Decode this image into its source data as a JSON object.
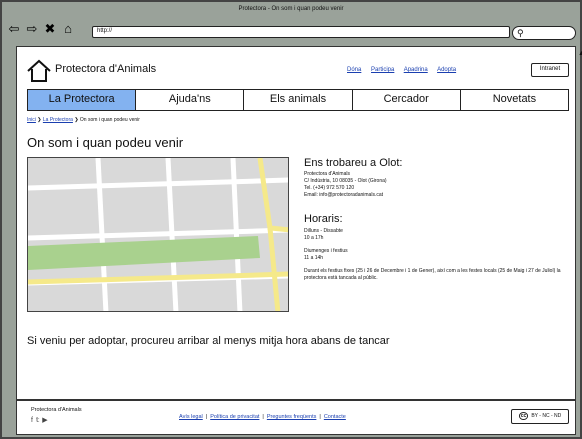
{
  "browser": {
    "window_title": "Protectora - On som i quan podeu venir",
    "url": "http://"
  },
  "header": {
    "site_title": "Protectora d'Animals",
    "links": [
      "Dóna",
      "Participa",
      "Apadrina",
      "Adopta"
    ],
    "intranet_label": "Intranet"
  },
  "nav": {
    "tabs": [
      "La Protectora",
      "Ajuda'ns",
      "Els animals",
      "Cercador",
      "Novetats"
    ]
  },
  "breadcrumb": {
    "items": [
      "Inici",
      "La Protectora"
    ],
    "current": "On som i quan podeu venir"
  },
  "page": {
    "title": "On som i quan podeu venir"
  },
  "location": {
    "heading": "Ens trobareu a Olot:",
    "name": "Protectora d'Animals",
    "address": "C/ Indústria, 10 08035 - Olot (Girona)",
    "phone": "Tel. (+34) 972 570 120",
    "email": "Email: info@protectoradanimals.cat"
  },
  "hours": {
    "heading": "Horaris:",
    "weekday_days": "Dilluns - Dissabte",
    "weekday_time": "10 a 17h",
    "sunday_days": "Diumenges i festius",
    "sunday_time": "11 a 14h",
    "note": "Durant els festius fixes (25 i 26 de Decembre i 1 de Gener), així com a les festes locals (25 de Maig i 27 de Juliol) la protectora està tancada al públic."
  },
  "adoption_note": "Si veniu per adoptar, procureu arribar al menys mitja hora abans de tancar",
  "footer": {
    "org": "Protectora d'Animals",
    "social_icons": [
      "facebook-icon",
      "twitter-icon",
      "youtube-icon"
    ],
    "links": [
      "Avís legal",
      "Política de privacitat",
      "Preguntes freqüents",
      "Contacte"
    ],
    "license_label": "BY - NC - ND",
    "license_mark": "cc"
  },
  "colors": {
    "active_tab": "#83b2f0",
    "link": "#1a3fb0",
    "map_road": "#f5e98a",
    "map_park": "#a9d18e",
    "chrome": "#9aa29a"
  }
}
